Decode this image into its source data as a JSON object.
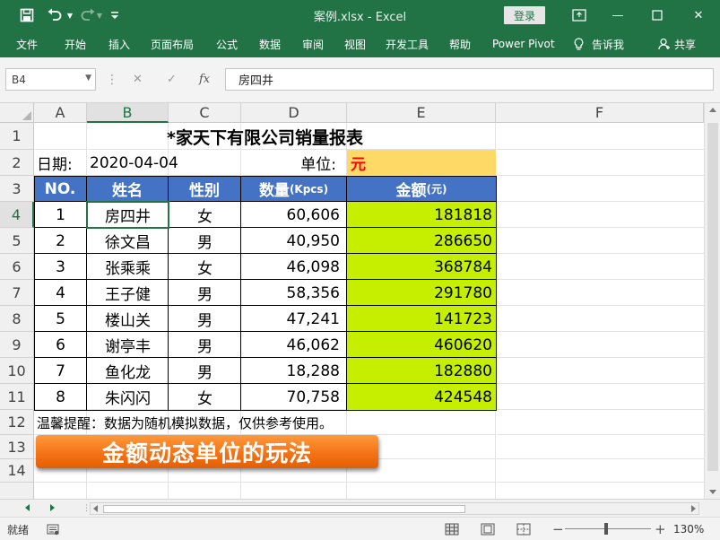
{
  "window": {
    "title": "案例.xlsx  -  Excel",
    "login": "登录",
    "controls": {
      "restore_icon": "▭",
      "minimize": "—",
      "maximize": "☐",
      "close": "✕"
    }
  },
  "quick_access": {
    "save": "save-icon",
    "undo": "undo-icon",
    "redo": "redo-icon",
    "customize": "customize-icon"
  },
  "ribbon": {
    "tabs": [
      "文件",
      "开始",
      "插入",
      "页面布局",
      "公式",
      "数据",
      "审阅",
      "视图",
      "开发工具",
      "帮助",
      "Power Pivot"
    ],
    "tell_me": "告诉我",
    "share": "共享"
  },
  "formula_bar": {
    "name_box": "B4",
    "content": "房四井"
  },
  "grid": {
    "columns": [
      "A",
      "B",
      "C",
      "D",
      "E",
      "F"
    ],
    "rows": [
      "1",
      "2",
      "3",
      "4",
      "5",
      "6",
      "7",
      "8",
      "9",
      "10",
      "11",
      "12",
      "13",
      "14"
    ]
  },
  "sheet": {
    "title": "*家天下有限公司销量报表",
    "date_label": "日期:",
    "date_value": "2020-04-04",
    "unit_label": "单位:",
    "unit_value": "元",
    "headers": {
      "no": "NO.",
      "name": "姓名",
      "gender": "性别",
      "qty": "数量",
      "qty_unit": "(Kpcs)",
      "amount": "金额",
      "amount_unit": "(元)"
    },
    "records": [
      {
        "no": "1",
        "name": "房四井",
        "gender": "女",
        "qty": "60,606",
        "amount": "181818"
      },
      {
        "no": "2",
        "name": "徐文昌",
        "gender": "男",
        "qty": "40,950",
        "amount": "286650"
      },
      {
        "no": "3",
        "name": "张乘乘",
        "gender": "女",
        "qty": "46,098",
        "amount": "368784"
      },
      {
        "no": "4",
        "name": "王子健",
        "gender": "男",
        "qty": "58,356",
        "amount": "291780"
      },
      {
        "no": "5",
        "name": "楼山关",
        "gender": "男",
        "qty": "47,241",
        "amount": "141723"
      },
      {
        "no": "6",
        "name": "谢亭丰",
        "gender": "男",
        "qty": "46,062",
        "amount": "460620"
      },
      {
        "no": "7",
        "name": "鱼化龙",
        "gender": "男",
        "qty": "18,288",
        "amount": "182880"
      },
      {
        "no": "8",
        "name": "朱闪闪",
        "gender": "女",
        "qty": "70,758",
        "amount": "424548"
      }
    ],
    "note": "温馨提醒：数据为随机模拟数据，仅供参考使用。",
    "banner": "金额动态单位的玩法"
  },
  "status": {
    "ready": "就绪",
    "zoom": "130%",
    "minus": "−",
    "plus": "+"
  },
  "colors": {
    "excel_green": "#217346",
    "header_blue": "#4472c4",
    "unit_yellow": "#ffd966",
    "amount_green": "#c6ef00",
    "unit_red": "#ff0000",
    "banner_orange": "#f47216"
  }
}
